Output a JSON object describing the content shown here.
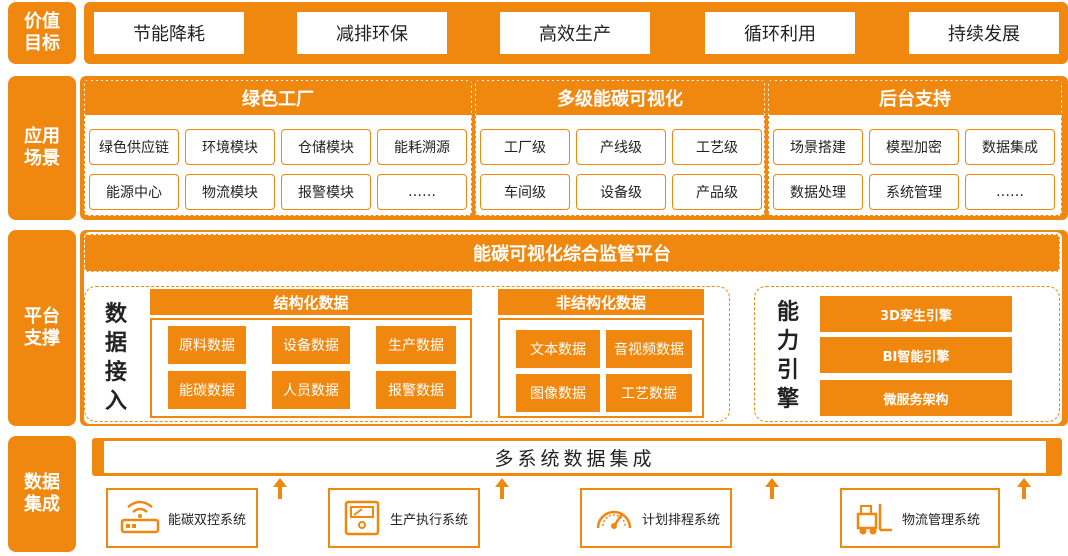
{
  "rows": {
    "value": "价值目标",
    "app": "应用场景",
    "platform": "平台支撑",
    "data": "数据集成"
  },
  "row_label_lines": {
    "value": [
      "价值",
      "目标"
    ],
    "app": [
      "应用",
      "场景"
    ],
    "platform": [
      "平台",
      "支撑"
    ],
    "data": [
      "数据",
      "集成"
    ]
  },
  "goals": [
    "节能降耗",
    "减排环保",
    "高效生产",
    "循环利用",
    "持续发展"
  ],
  "apps": [
    {
      "title": "绿色工厂",
      "modules": [
        "绿色供应链",
        "环境模块",
        "仓储模块",
        "能耗溯源",
        "能源中心",
        "物流模块",
        "报警模块",
        "……"
      ]
    },
    {
      "title": "多级能碳可视化",
      "modules": [
        "工厂级",
        "产线级",
        "工艺级",
        "车间级",
        "设备级",
        "产品级"
      ]
    },
    {
      "title": "后台支持",
      "modules": [
        "场景搭建",
        "模型加密",
        "数据集成",
        "数据处理",
        "系统管理",
        "……"
      ]
    }
  ],
  "platform": {
    "title": "能碳可视化综合监管平台",
    "data_access": [
      "数",
      "据",
      "接",
      "入"
    ],
    "structured": {
      "title": "结构化数据",
      "items": [
        "原料数据",
        "设备数据",
        "生产数据",
        "能碳数据",
        "人员数据",
        "报警数据"
      ]
    },
    "unstructured": {
      "title": "非结构化数据",
      "items": [
        "文本数据",
        "音视频数据",
        "图像数据",
        "工艺数据"
      ]
    },
    "capability": [
      "能",
      "力",
      "引",
      "擎"
    ],
    "engines": [
      "3D孪生引擎",
      "BI智能引擎",
      "微服务架构"
    ]
  },
  "integration": {
    "title": "多系统数据集成",
    "systems": [
      {
        "label": "能碳双控系统",
        "icon": "router-icon"
      },
      {
        "label": "生产执行系统",
        "icon": "meter-icon"
      },
      {
        "label": "计划排程系统",
        "icon": "gauge-icon"
      },
      {
        "label": "物流管理系统",
        "icon": "forklift-icon"
      }
    ]
  },
  "colors": {
    "accent": "#F0870F",
    "text": "#222222",
    "background": "#FFFFFF"
  }
}
